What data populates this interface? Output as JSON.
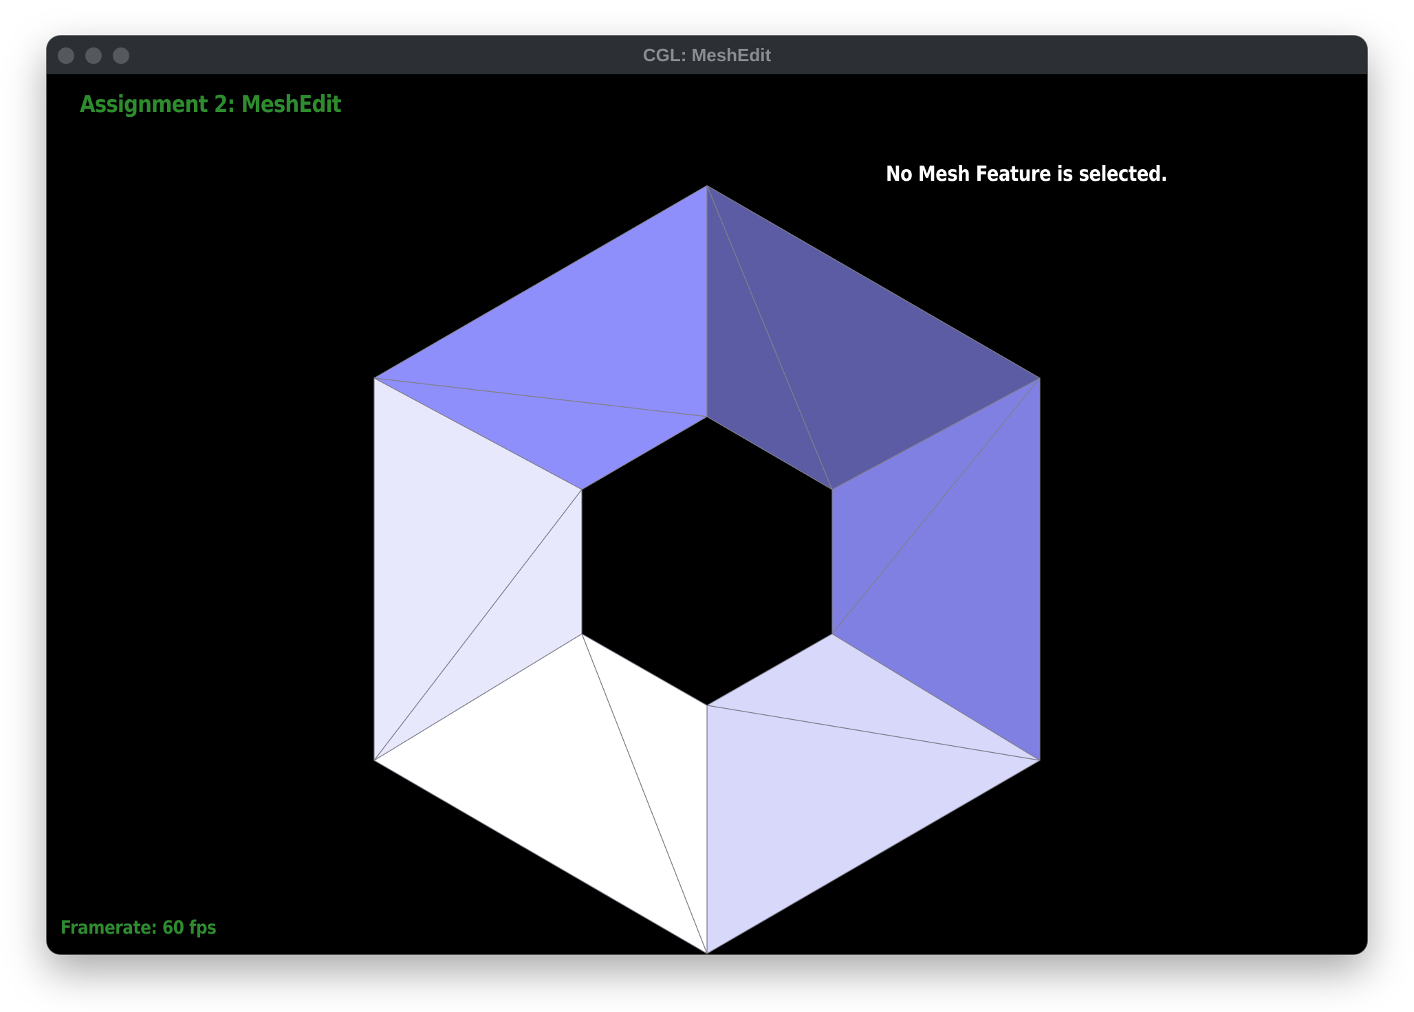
{
  "window": {
    "title": "CGL: MeshEdit"
  },
  "viewport": {
    "heading": "Assignment 2: MeshEdit",
    "selection_status": "No Mesh Feature is selected.",
    "framerate": "Framerate: 60 fps",
    "heading_color": "#2e8b2e",
    "background_color": "#000000"
  },
  "mesh": {
    "shape": "hexagonal ring of 12 triangles",
    "edge_color": "#7f7f8c",
    "face_colors": {
      "top_left": "#8f8ffb",
      "top_right": "#5c5ca4",
      "right": "#8080e3",
      "bottom_right": "#d8d8fb",
      "bottom_left": "#ffffff",
      "left": "#e8e8fd"
    }
  }
}
